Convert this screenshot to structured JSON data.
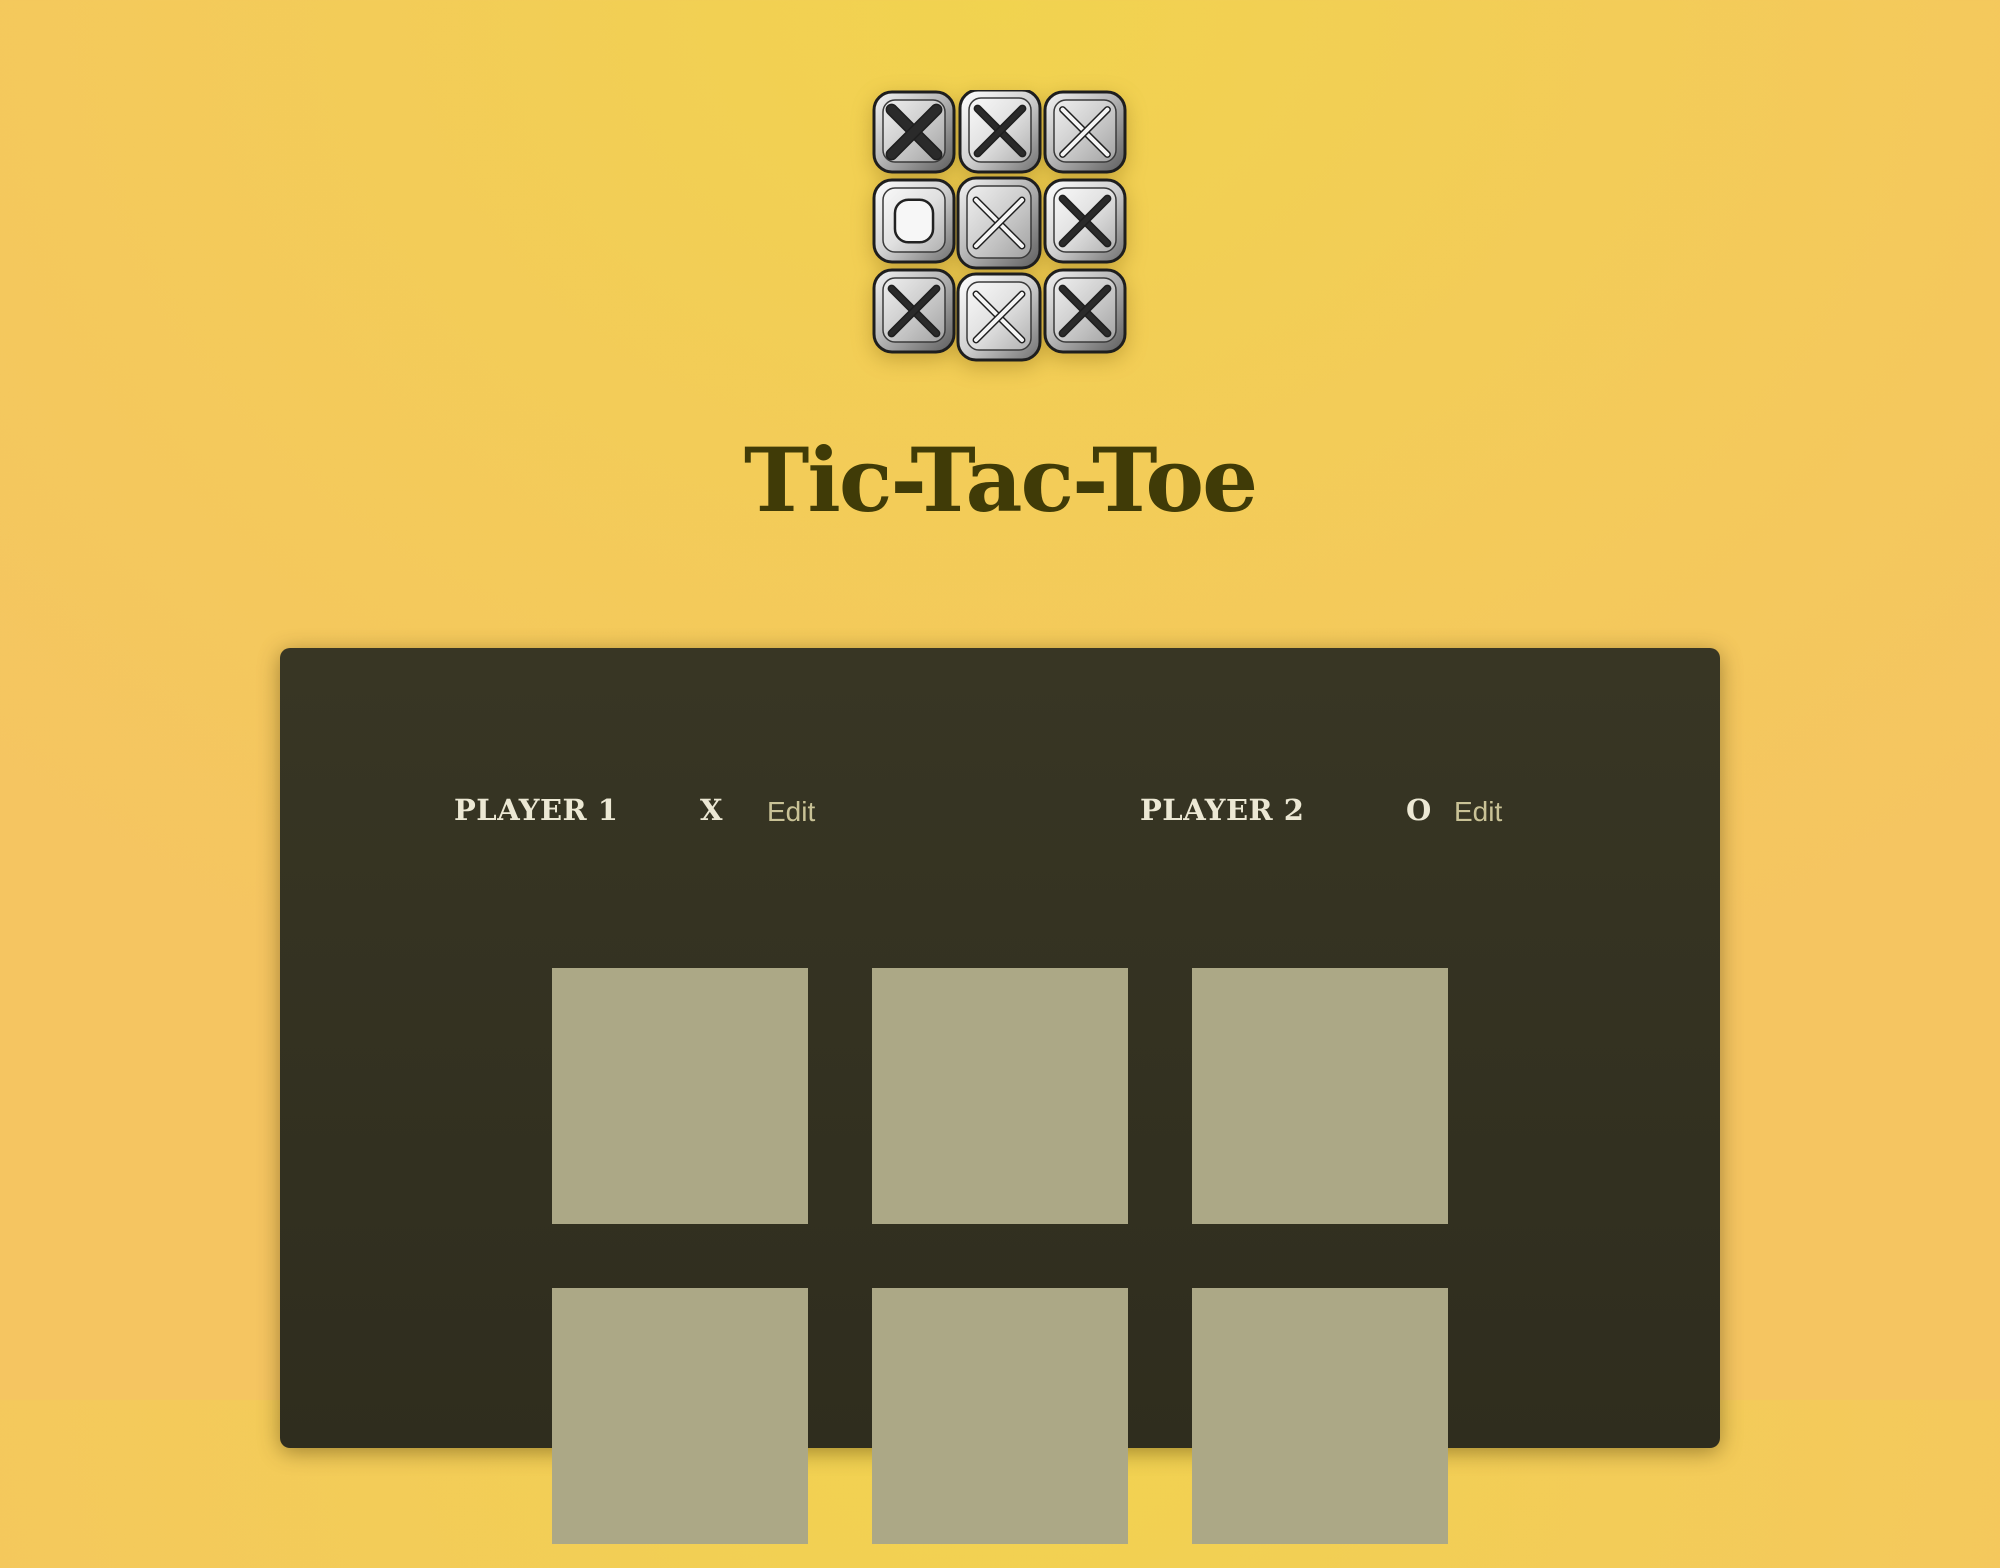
{
  "header": {
    "logo_icon": "tic-tac-toe-logo-icon",
    "title": "Tic-Tac-Toe"
  },
  "players": [
    {
      "name": "PLAYER 1",
      "symbol": "X",
      "edit_label": "Edit"
    },
    {
      "name": "PLAYER 2",
      "symbol": "O",
      "edit_label": "Edit"
    }
  ],
  "board": {
    "cells": [
      "",
      "",
      "",
      "",
      "",
      "",
      "",
      "",
      ""
    ]
  },
  "colors": {
    "background": "#f2cf55",
    "title": "#403b07",
    "panel": "#343222",
    "cell": "#aca886",
    "player_text": "#ece8d4",
    "edit_text": "#c9c296"
  }
}
